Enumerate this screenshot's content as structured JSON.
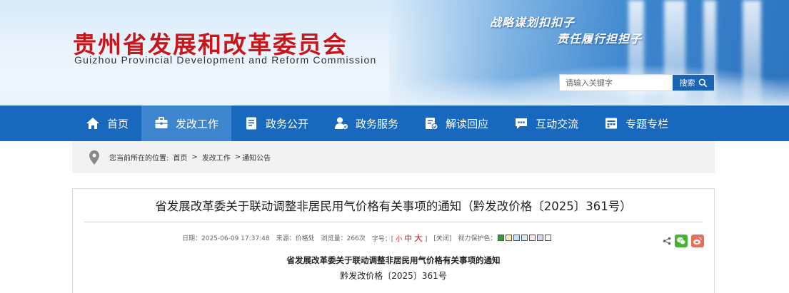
{
  "header": {
    "title_cn": "贵州省发展和改革委员会",
    "title_en": "Guizhou Provincial Development and Reform Commission",
    "slogan_1": "战略谋划扣扣子",
    "slogan_2": "责任履行担担子"
  },
  "search": {
    "placeholder": "请输入关键字",
    "button_label": "搜索"
  },
  "nav": {
    "items": [
      {
        "label": "首页",
        "icon": "home-icon"
      },
      {
        "label": "发改工作",
        "icon": "briefcase-icon"
      },
      {
        "label": "政务公开",
        "icon": "document-icon"
      },
      {
        "label": "政务服务",
        "icon": "person-service-icon"
      },
      {
        "label": "解读回应",
        "icon": "clipboard-check-icon"
      },
      {
        "label": "互动交流",
        "icon": "chat-icon"
      },
      {
        "label": "专题专栏",
        "icon": "calendar-icon"
      }
    ],
    "active_index": 1
  },
  "breadcrumb": {
    "prefix": "您当前所在的位置:",
    "items": [
      "首页",
      "发改工作",
      "通知公告"
    ],
    "separators": [
      ">",
      ">"
    ]
  },
  "article": {
    "title": "省发展改革委关于联动调整非居民用气价格有关事项的通知（黔发改价格〔2025〕361号）",
    "meta": {
      "date": "日期：2025-06-09 17:37:48",
      "source": "来源：价格处",
      "views": "浏览量：266次",
      "font_size_label": "字号：[",
      "font_small": "小",
      "font_mid": "中",
      "font_big": "大",
      "font_size_close": "]",
      "close_label": "[关闭]",
      "eye_protect_label": "视力保护色："
    },
    "eye_colors": [
      "#3a9a3a",
      "#f7f2b0",
      "#c6e4f7",
      "#dde8f2",
      "#f7e4ef",
      "#e0d4f2",
      "#ffffff"
    ],
    "body_title": "省发展改革委关于联动调整非居民用气价格有关事项的通知",
    "doc_number": "黔发改价格〔2025〕361号"
  },
  "share": {
    "icons": [
      "share-icon",
      "wechat-icon",
      "weibo-icon"
    ]
  },
  "colors": {
    "nav_bg": "#1868bd",
    "nav_active": "#3d86cf",
    "title_red": "#c8161d",
    "search_btn": "#1a64b4"
  }
}
